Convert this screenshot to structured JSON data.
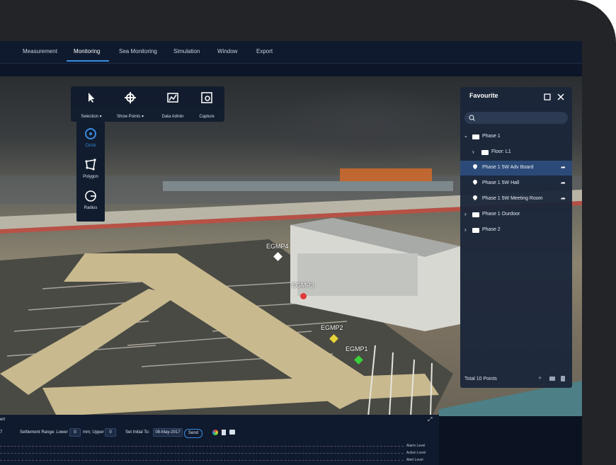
{
  "menu": {
    "items": [
      "Measurement",
      "Monitoring",
      "Sea Monitoring",
      "Simulation",
      "Window",
      "Export"
    ],
    "active": "Monitoring"
  },
  "toolbox": {
    "tools": [
      {
        "label": "Selection ▾",
        "icon": "cursor-icon"
      },
      {
        "label": "Show Points ▾",
        "icon": "crosshair-icon"
      },
      {
        "label": "Data Admin",
        "icon": "chart-icon"
      },
      {
        "label": "Capture",
        "icon": "camera-icon"
      }
    ],
    "selection_modes": [
      {
        "label": "Circle",
        "icon": "circle-select-icon",
        "active": true
      },
      {
        "label": "Polygon",
        "icon": "polygon-select-icon",
        "active": false
      },
      {
        "label": "Radius",
        "icon": "radius-select-icon",
        "active": false
      }
    ]
  },
  "map": {
    "markers": [
      {
        "label": "EGMP4",
        "color": "#ffffff"
      },
      {
        "label": "EGMP3",
        "color": "#e23a3a"
      },
      {
        "label": "EGMP2",
        "color": "#e8d23a"
      },
      {
        "label": "EGMP1",
        "color": "#3ad23a"
      }
    ]
  },
  "favourite": {
    "title": "Favourite",
    "tree": [
      {
        "label": "Phase 1",
        "type": "folder",
        "expanded": true
      },
      {
        "label": "Floor: L1",
        "type": "folder",
        "expanded": false
      },
      {
        "label": "Phase 1 5W Adv Board",
        "type": "point",
        "selected": true
      },
      {
        "label": "Phase 1 5W Hall",
        "type": "point",
        "selected": false
      },
      {
        "label": "Phase 1 5W Meeting Room",
        "type": "point",
        "selected": false
      },
      {
        "label": "Phase 1 Ourdoor",
        "type": "folder",
        "expanded": false
      },
      {
        "label": "Phase 2",
        "type": "folder",
        "expanded": false
      }
    ],
    "footer": "Total 10 Points"
  },
  "bottom": {
    "title_partial": "ert",
    "day_partial": "7",
    "range_label": "Settlement Range: Lower",
    "lower_value": "0",
    "mm_upper": "mm; Upper",
    "upper_value": "0",
    "initial_label": "Set Initial To:",
    "initial_value": "08-May-2017",
    "send_label": "Send",
    "levels": [
      "Alarm Level",
      "Action Level",
      "Alert Level"
    ]
  }
}
